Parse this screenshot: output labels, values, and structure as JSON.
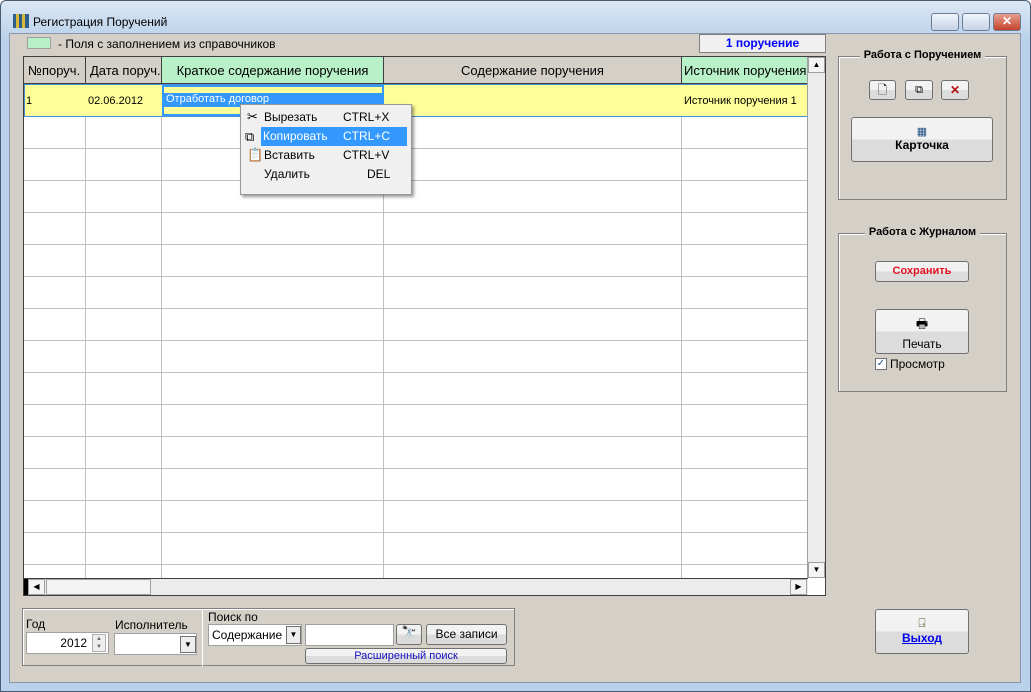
{
  "window": {
    "title": "Регистрация Поручений"
  },
  "legend": {
    "text": "- Поля с заполнением из справочников",
    "color": "#b8f0c8"
  },
  "counter": "1 поручение",
  "grid": {
    "columns": [
      "№поруч.",
      "Дата поруч.",
      "Краткое содержание поручения",
      "Содержание поручения",
      "Источник поручения"
    ],
    "rows": [
      {
        "num": "1",
        "date": "02.06.2012",
        "brief": "Отработать договор",
        "content": "",
        "source": "Источник поручения 1"
      }
    ]
  },
  "context_menu": {
    "items": [
      {
        "label": "Вырезать",
        "shortcut": "CTRL+X",
        "icon": "scissors-icon"
      },
      {
        "label": "Копировать",
        "shortcut": "CTRL+C",
        "icon": "copy-icon"
      },
      {
        "label": "Вставить",
        "shortcut": "CTRL+V",
        "icon": "paste-icon"
      },
      {
        "label": "Удалить",
        "shortcut": "DEL"
      }
    ]
  },
  "task_group": {
    "title": "Работа с Поручением",
    "card_label": "Карточка"
  },
  "journal_group": {
    "title": "Работа с Журналом",
    "save_label": "Сохранить",
    "print_label": "Печать",
    "preview_label": "Просмотр",
    "preview_checked": true
  },
  "exit_label": "Выход",
  "filters": {
    "year_label": "Год",
    "year_value": "2012",
    "executor_label": "Исполнитель",
    "executor_value": "",
    "search_label": "Поиск по",
    "search_field": "Содержание",
    "search_value": "",
    "all_records_label": "Все записи",
    "advanced_search_label": "Расширенный поиск"
  }
}
